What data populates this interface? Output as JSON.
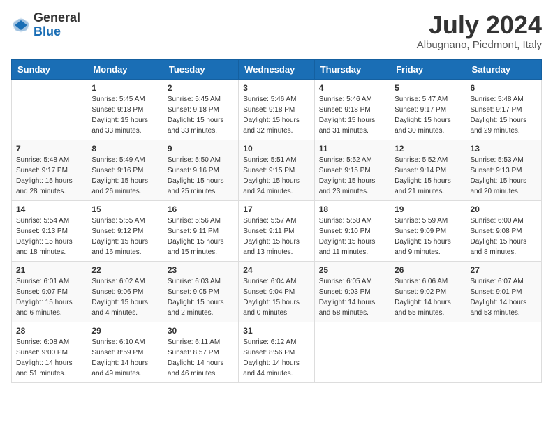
{
  "header": {
    "logo_line1": "General",
    "logo_line2": "Blue",
    "month_year": "July 2024",
    "location": "Albugnano, Piedmont, Italy"
  },
  "weekdays": [
    "Sunday",
    "Monday",
    "Tuesday",
    "Wednesday",
    "Thursday",
    "Friday",
    "Saturday"
  ],
  "weeks": [
    [
      {
        "day": "",
        "sunrise": "",
        "sunset": "",
        "daylight": ""
      },
      {
        "day": "1",
        "sunrise": "Sunrise: 5:45 AM",
        "sunset": "Sunset: 9:18 PM",
        "daylight": "Daylight: 15 hours and 33 minutes."
      },
      {
        "day": "2",
        "sunrise": "Sunrise: 5:45 AM",
        "sunset": "Sunset: 9:18 PM",
        "daylight": "Daylight: 15 hours and 33 minutes."
      },
      {
        "day": "3",
        "sunrise": "Sunrise: 5:46 AM",
        "sunset": "Sunset: 9:18 PM",
        "daylight": "Daylight: 15 hours and 32 minutes."
      },
      {
        "day": "4",
        "sunrise": "Sunrise: 5:46 AM",
        "sunset": "Sunset: 9:18 PM",
        "daylight": "Daylight: 15 hours and 31 minutes."
      },
      {
        "day": "5",
        "sunrise": "Sunrise: 5:47 AM",
        "sunset": "Sunset: 9:17 PM",
        "daylight": "Daylight: 15 hours and 30 minutes."
      },
      {
        "day": "6",
        "sunrise": "Sunrise: 5:48 AM",
        "sunset": "Sunset: 9:17 PM",
        "daylight": "Daylight: 15 hours and 29 minutes."
      }
    ],
    [
      {
        "day": "7",
        "sunrise": "Sunrise: 5:48 AM",
        "sunset": "Sunset: 9:17 PM",
        "daylight": "Daylight: 15 hours and 28 minutes."
      },
      {
        "day": "8",
        "sunrise": "Sunrise: 5:49 AM",
        "sunset": "Sunset: 9:16 PM",
        "daylight": "Daylight: 15 hours and 26 minutes."
      },
      {
        "day": "9",
        "sunrise": "Sunrise: 5:50 AM",
        "sunset": "Sunset: 9:16 PM",
        "daylight": "Daylight: 15 hours and 25 minutes."
      },
      {
        "day": "10",
        "sunrise": "Sunrise: 5:51 AM",
        "sunset": "Sunset: 9:15 PM",
        "daylight": "Daylight: 15 hours and 24 minutes."
      },
      {
        "day": "11",
        "sunrise": "Sunrise: 5:52 AM",
        "sunset": "Sunset: 9:15 PM",
        "daylight": "Daylight: 15 hours and 23 minutes."
      },
      {
        "day": "12",
        "sunrise": "Sunrise: 5:52 AM",
        "sunset": "Sunset: 9:14 PM",
        "daylight": "Daylight: 15 hours and 21 minutes."
      },
      {
        "day": "13",
        "sunrise": "Sunrise: 5:53 AM",
        "sunset": "Sunset: 9:13 PM",
        "daylight": "Daylight: 15 hours and 20 minutes."
      }
    ],
    [
      {
        "day": "14",
        "sunrise": "Sunrise: 5:54 AM",
        "sunset": "Sunset: 9:13 PM",
        "daylight": "Daylight: 15 hours and 18 minutes."
      },
      {
        "day": "15",
        "sunrise": "Sunrise: 5:55 AM",
        "sunset": "Sunset: 9:12 PM",
        "daylight": "Daylight: 15 hours and 16 minutes."
      },
      {
        "day": "16",
        "sunrise": "Sunrise: 5:56 AM",
        "sunset": "Sunset: 9:11 PM",
        "daylight": "Daylight: 15 hours and 15 minutes."
      },
      {
        "day": "17",
        "sunrise": "Sunrise: 5:57 AM",
        "sunset": "Sunset: 9:11 PM",
        "daylight": "Daylight: 15 hours and 13 minutes."
      },
      {
        "day": "18",
        "sunrise": "Sunrise: 5:58 AM",
        "sunset": "Sunset: 9:10 PM",
        "daylight": "Daylight: 15 hours and 11 minutes."
      },
      {
        "day": "19",
        "sunrise": "Sunrise: 5:59 AM",
        "sunset": "Sunset: 9:09 PM",
        "daylight": "Daylight: 15 hours and 9 minutes."
      },
      {
        "day": "20",
        "sunrise": "Sunrise: 6:00 AM",
        "sunset": "Sunset: 9:08 PM",
        "daylight": "Daylight: 15 hours and 8 minutes."
      }
    ],
    [
      {
        "day": "21",
        "sunrise": "Sunrise: 6:01 AM",
        "sunset": "Sunset: 9:07 PM",
        "daylight": "Daylight: 15 hours and 6 minutes."
      },
      {
        "day": "22",
        "sunrise": "Sunrise: 6:02 AM",
        "sunset": "Sunset: 9:06 PM",
        "daylight": "Daylight: 15 hours and 4 minutes."
      },
      {
        "day": "23",
        "sunrise": "Sunrise: 6:03 AM",
        "sunset": "Sunset: 9:05 PM",
        "daylight": "Daylight: 15 hours and 2 minutes."
      },
      {
        "day": "24",
        "sunrise": "Sunrise: 6:04 AM",
        "sunset": "Sunset: 9:04 PM",
        "daylight": "Daylight: 15 hours and 0 minutes."
      },
      {
        "day": "25",
        "sunrise": "Sunrise: 6:05 AM",
        "sunset": "Sunset: 9:03 PM",
        "daylight": "Daylight: 14 hours and 58 minutes."
      },
      {
        "day": "26",
        "sunrise": "Sunrise: 6:06 AM",
        "sunset": "Sunset: 9:02 PM",
        "daylight": "Daylight: 14 hours and 55 minutes."
      },
      {
        "day": "27",
        "sunrise": "Sunrise: 6:07 AM",
        "sunset": "Sunset: 9:01 PM",
        "daylight": "Daylight: 14 hours and 53 minutes."
      }
    ],
    [
      {
        "day": "28",
        "sunrise": "Sunrise: 6:08 AM",
        "sunset": "Sunset: 9:00 PM",
        "daylight": "Daylight: 14 hours and 51 minutes."
      },
      {
        "day": "29",
        "sunrise": "Sunrise: 6:10 AM",
        "sunset": "Sunset: 8:59 PM",
        "daylight": "Daylight: 14 hours and 49 minutes."
      },
      {
        "day": "30",
        "sunrise": "Sunrise: 6:11 AM",
        "sunset": "Sunset: 8:57 PM",
        "daylight": "Daylight: 14 hours and 46 minutes."
      },
      {
        "day": "31",
        "sunrise": "Sunrise: 6:12 AM",
        "sunset": "Sunset: 8:56 PM",
        "daylight": "Daylight: 14 hours and 44 minutes."
      },
      {
        "day": "",
        "sunrise": "",
        "sunset": "",
        "daylight": ""
      },
      {
        "day": "",
        "sunrise": "",
        "sunset": "",
        "daylight": ""
      },
      {
        "day": "",
        "sunrise": "",
        "sunset": "",
        "daylight": ""
      }
    ]
  ]
}
